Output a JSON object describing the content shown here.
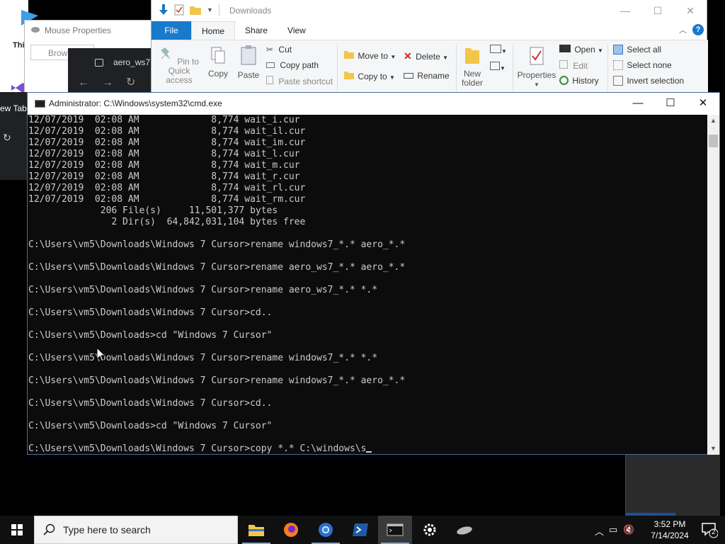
{
  "desktop": {
    "left_label": "Thi"
  },
  "mouse_properties": {
    "title": "Mouse Properties",
    "tab": "Brow"
  },
  "browser": {
    "tab_title": "aero_ws7",
    "left_label": "ew Tab"
  },
  "explorer": {
    "title": "Downloads",
    "tabs": [
      "File",
      "Home",
      "Share",
      "View"
    ],
    "active_tab": "Home",
    "ribbon": {
      "pin": "Pin to Quick access",
      "copy": "Copy",
      "paste": "Paste",
      "cut": "Cut",
      "copy_path": "Copy path",
      "paste_shortcut": "Paste shortcut",
      "move_to": "Move to",
      "copy_to": "Copy to",
      "delete": "Delete",
      "rename": "Rename",
      "new_folder": "New folder",
      "properties": "Properties",
      "open": "Open",
      "edit": "Edit",
      "history": "History",
      "select_all": "Select all",
      "select_none": "Select none",
      "invert_selection": "Invert selection"
    }
  },
  "cmd": {
    "title": "Administrator: C:\\Windows\\system32\\cmd.exe",
    "lines": [
      "12/07/2019  02:08 AM             8,774 wait_i.cur",
      "12/07/2019  02:08 AM             8,774 wait_il.cur",
      "12/07/2019  02:08 AM             8,774 wait_im.cur",
      "12/07/2019  02:08 AM             8,774 wait_l.cur",
      "12/07/2019  02:08 AM             8,774 wait_m.cur",
      "12/07/2019  02:08 AM             8,774 wait_r.cur",
      "12/07/2019  02:08 AM             8,774 wait_rl.cur",
      "12/07/2019  02:08 AM             8,774 wait_rm.cur",
      "             206 File(s)     11,501,377 bytes",
      "               2 Dir(s)  64,842,031,104 bytes free",
      "",
      "C:\\Users\\vm5\\Downloads\\Windows 7 Cursor>rename windows7_*.* aero_*.*",
      "",
      "C:\\Users\\vm5\\Downloads\\Windows 7 Cursor>rename aero_ws7_*.* aero_*.*",
      "",
      "C:\\Users\\vm5\\Downloads\\Windows 7 Cursor>rename aero_ws7_*.* *.*",
      "",
      "C:\\Users\\vm5\\Downloads\\Windows 7 Cursor>cd..",
      "",
      "C:\\Users\\vm5\\Downloads>cd \"Windows 7 Cursor\"",
      "",
      "C:\\Users\\vm5\\Downloads\\Windows 7 Cursor>rename windows7_*.* *.*",
      "",
      "C:\\Users\\vm5\\Downloads\\Windows 7 Cursor>rename windows7_*.* aero_*.*",
      "",
      "C:\\Users\\vm5\\Downloads\\Windows 7 Cursor>cd..",
      "",
      "C:\\Users\\vm5\\Downloads>cd \"Windows 7 Cursor\"",
      ""
    ],
    "current_input": "C:\\Users\\vm5\\Downloads\\Windows 7 Cursor>copy *.* C:\\windows\\s"
  },
  "taskbar": {
    "search_placeholder": "Type here to search",
    "apps": [
      "file-explorer",
      "firefox",
      "chrome",
      "powershell",
      "cmd",
      "settings",
      "mouse"
    ],
    "active_app": "cmd",
    "time": "3:52 PM",
    "date": "7/14/2024",
    "notification_count": "2"
  }
}
